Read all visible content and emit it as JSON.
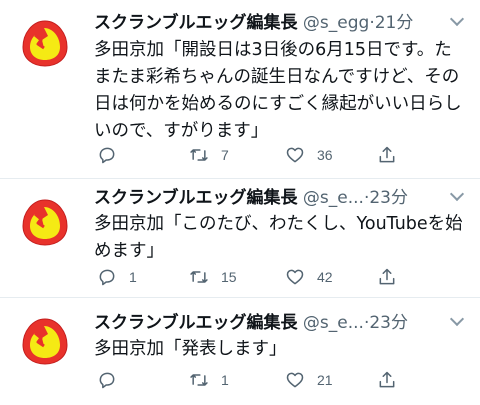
{
  "colors": {
    "text": "#0f1419",
    "muted": "#536471",
    "divider": "#e6ecf0",
    "avatar_red": "#e8322b",
    "avatar_yellow": "#f5ea14"
  },
  "tweets": [
    {
      "name": "スクランブルエッグ編集長",
      "handle": "@s_egg",
      "dot": "·",
      "time": "21分",
      "text": "多田京加「開設日は3日後の6月15日です。たまたま彩希ちゃんの誕生日なんですけど、その日は何かを始めるのにすごく縁起がいい日らしいので、すがります」",
      "reply_count": "",
      "retweet_count": "7",
      "like_count": "36"
    },
    {
      "name": "スクランブルエッグ編集長",
      "handle": "@s_e...",
      "dot": "·",
      "time": "23分",
      "text": "多田京加「このたび、わたくし、YouTubeを始めます」",
      "reply_count": "1",
      "retweet_count": "15",
      "like_count": "42"
    },
    {
      "name": "スクランブルエッグ編集長",
      "handle": "@s_e...",
      "dot": "·",
      "time": "23分",
      "text": "多田京加「発表します」",
      "reply_count": "",
      "retweet_count": "1",
      "like_count": "21"
    }
  ],
  "icons": [
    "egg-avatar-icon",
    "reply-icon",
    "retweet-icon",
    "like-icon",
    "share-icon",
    "chevron-down-icon"
  ]
}
